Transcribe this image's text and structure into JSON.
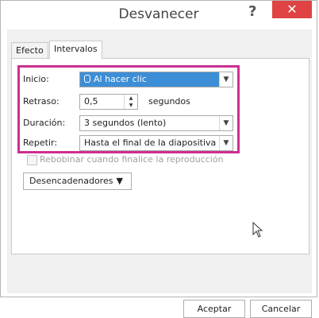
{
  "window": {
    "title": "Desvanecer",
    "help_label": "?",
    "close_label": "✕"
  },
  "tabs": [
    {
      "label": "Efecto"
    },
    {
      "label": "Intervalos"
    }
  ],
  "form": {
    "inicio": {
      "label": "Inicio:",
      "value": "Al hacer clic"
    },
    "retraso": {
      "label": "Retraso:",
      "value": "0,5",
      "unit": "segundos"
    },
    "duracion": {
      "label": "Duración:",
      "value": "3 segundos (lento)"
    },
    "repetir": {
      "label": "Repetir:",
      "value": "Hasta el final de la diapositiva"
    },
    "rebobinar": {
      "label": "Rebobinar cuando finalice la reproducción",
      "checked": false
    },
    "triggers_label": "Desencadenadores"
  },
  "buttons": {
    "accept": "Aceptar",
    "cancel": "Cancelar"
  },
  "colors": {
    "highlight": "#cc2f91",
    "close_bg": "#e04343",
    "selection": "#3c8ed6"
  },
  "icons": {
    "close": "close-icon",
    "help": "help-icon",
    "dropdown": "chevron-down-icon",
    "spin": "spin-arrows-icon",
    "mouse": "mouse-click-icon",
    "cursor": "arrow-cursor-icon",
    "triggers_menu": "triangle-menu-icon"
  }
}
